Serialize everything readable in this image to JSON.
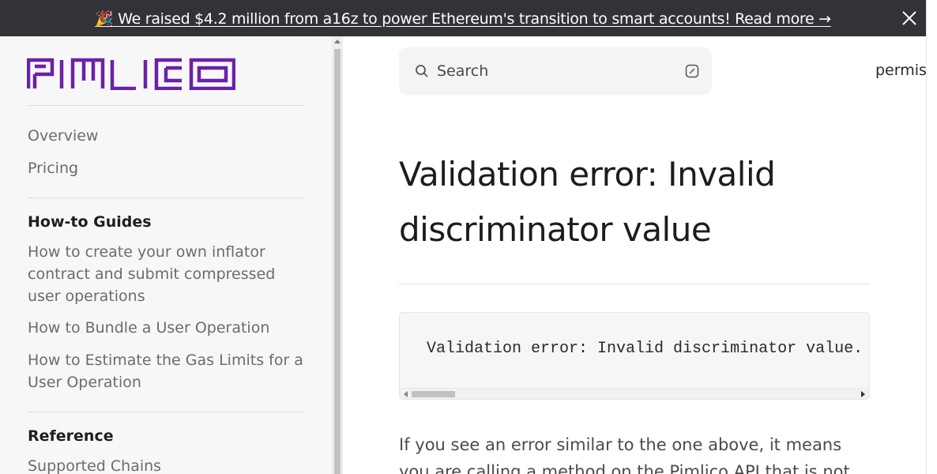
{
  "banner": {
    "emoji": "🎉",
    "text": " We raised $4.2 million from a16z to power Ethereum's transition to smart accounts! Read more →"
  },
  "logo": {
    "text": "PIMLICO",
    "color": "#6b21a8"
  },
  "sidebar": {
    "top_links": [
      {
        "label": "Overview"
      },
      {
        "label": "Pricing"
      }
    ],
    "sections": [
      {
        "heading": "How-to Guides",
        "items": [
          {
            "label": "How to create your own inflator contract and submit compressed user operations"
          },
          {
            "label": "How to Bundle a User Operation"
          },
          {
            "label": "How to Estimate the Gas Limits for a User Operation"
          }
        ]
      },
      {
        "heading": "Reference",
        "items": [
          {
            "label": "Supported Chains"
          }
        ]
      }
    ]
  },
  "search": {
    "placeholder": "Search"
  },
  "top_nav": {
    "link": "permis"
  },
  "main": {
    "title": "Validation error: Invalid discriminator value",
    "code": "Validation error: Invalid discriminator value.",
    "paragraph": "If you see an error similar to the one above, it means you are calling a method on the Pimlico API that is not"
  }
}
